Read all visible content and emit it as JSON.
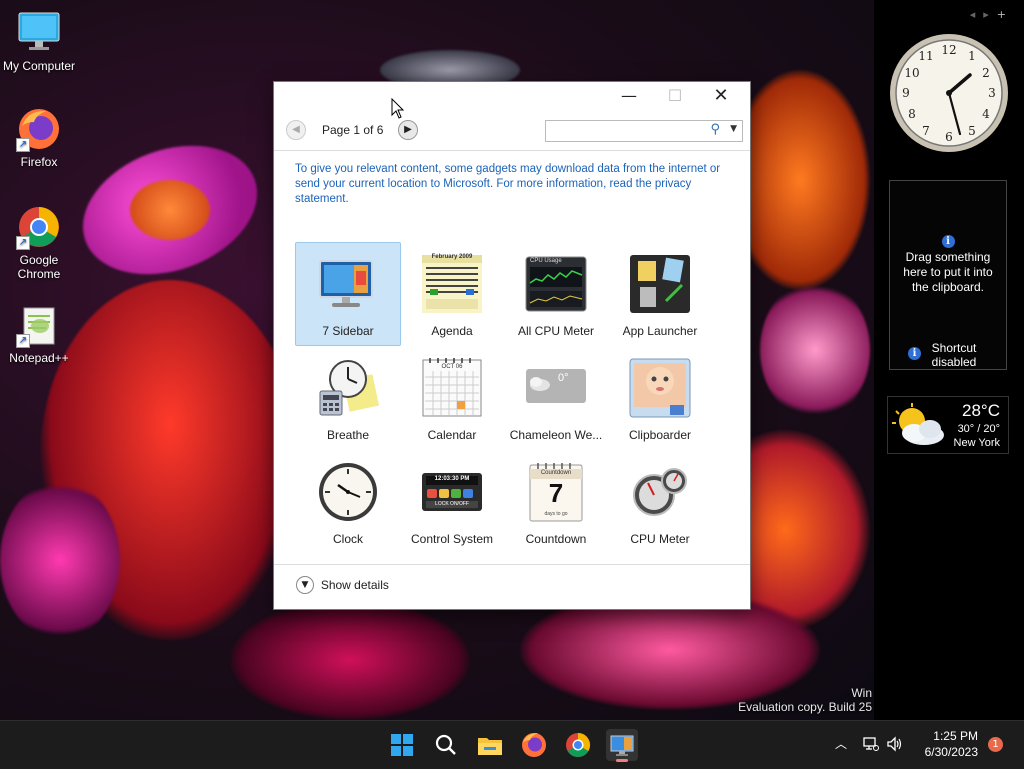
{
  "desktop": {
    "icons": [
      {
        "label": "My Computer",
        "icon": "monitor-icon"
      },
      {
        "label": "Firefox",
        "icon": "firefox-icon"
      },
      {
        "label": "Google Chrome",
        "icon": "chrome-icon"
      },
      {
        "label": "Notepad++",
        "icon": "notepadpp-icon"
      }
    ],
    "watermark_line1": "Win",
    "watermark_line2": "Evaluation copy. Build 25"
  },
  "sidebar": {
    "clipboard": {
      "message": "Drag something here to put it into the clipboard.",
      "shortcut": "Shortcut disabled"
    },
    "weather": {
      "temp": "28°C",
      "range": "30° / 20°",
      "city": "New York"
    }
  },
  "window": {
    "pager": "Page 1 of 6",
    "search": {
      "value": ""
    },
    "notice": "To give you relevant content, some gadgets may download data from the internet or send your current location to Microsoft. For more information, read the privacy statement.",
    "gadgets": [
      {
        "name": "7 Sidebar",
        "selected": true
      },
      {
        "name": "Agenda"
      },
      {
        "name": "All CPU Meter"
      },
      {
        "name": "App Launcher"
      },
      {
        "name": "Breathe"
      },
      {
        "name": "Calendar"
      },
      {
        "name": "Chameleon We..."
      },
      {
        "name": "Clipboarder"
      },
      {
        "name": "Clock"
      },
      {
        "name": "Control System"
      },
      {
        "name": "Countdown"
      },
      {
        "name": "CPU Meter"
      }
    ],
    "thumb_text": {
      "agenda_header": "February 2009",
      "cpu_title": "CPU Usage",
      "calendar_month": "OCT 06",
      "chameleon_temp": "0°",
      "control_time": "12:03:30 PM",
      "control_lock": "LOCK ON/OFF",
      "countdown_title": "Countdown",
      "countdown_number": "7",
      "countdown_caption": "days to go"
    },
    "details_label": "Show details"
  },
  "taskbar": {
    "time": "1:25 PM",
    "date": "6/30/2023",
    "notification_count": "1"
  },
  "colors": {
    "accent": "#0067c0",
    "link": "#1c63b8",
    "selection": "#cce4f7",
    "taskbar": "#1c1c1c"
  }
}
